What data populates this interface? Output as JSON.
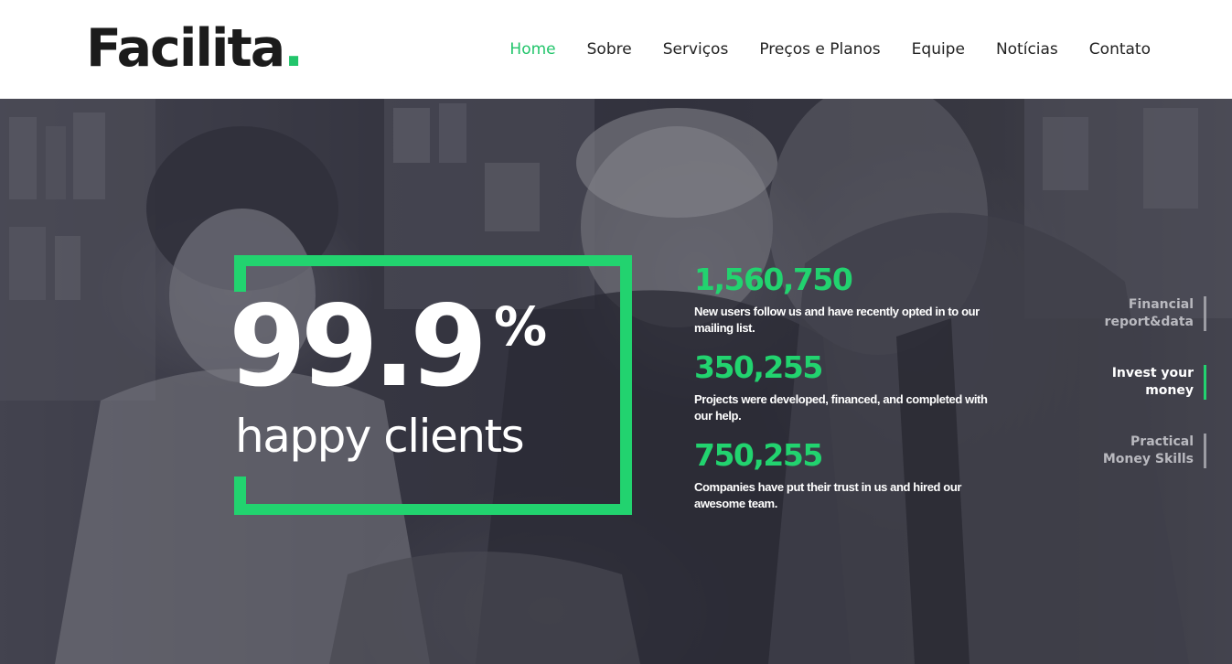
{
  "header": {
    "logo_text": "Facilita",
    "logo_dot": ".",
    "nav": [
      {
        "label": "Home",
        "active": true
      },
      {
        "label": "Sobre"
      },
      {
        "label": "Serviços"
      },
      {
        "label": "Preços e Planos"
      },
      {
        "label": "Equipe"
      },
      {
        "label": "Notícias"
      },
      {
        "label": "Contato"
      }
    ]
  },
  "hero": {
    "big_stat": {
      "number": "99.9",
      "unit": "%",
      "label": "happy clients"
    },
    "stats": [
      {
        "number": "1,560,750",
        "description": "New users follow us and have recently opted in to our mailing list."
      },
      {
        "number": "350,255",
        "description": "Projects were developed, financed, and completed with our help."
      },
      {
        "number": "750,255",
        "description": "Companies have put their trust in us and hired our awesome team."
      }
    ],
    "side_menu": [
      {
        "label": "Financial report&data",
        "active": false
      },
      {
        "label": "Invest your money",
        "active": true
      },
      {
        "label": "Practical Money Skills",
        "active": false
      }
    ]
  },
  "colors": {
    "accent": "#22d36f",
    "text_dark": "#1b1b1b"
  }
}
